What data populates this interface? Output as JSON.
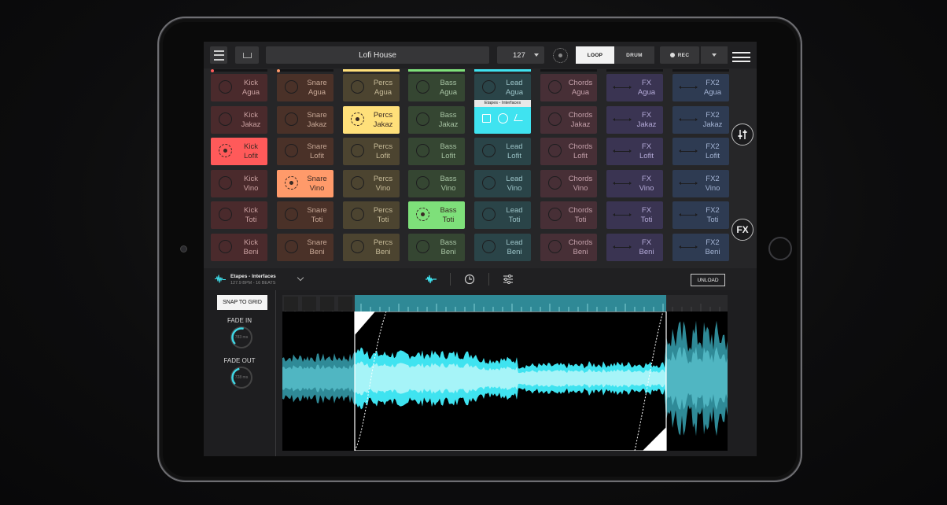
{
  "topbar": {
    "title": "Lofi House",
    "bpm": "127",
    "mode_loop": "LOOP",
    "mode_drum": "DRUM",
    "rec_label": "REC"
  },
  "columns": [
    {
      "name": "Kick",
      "color": "#ff5a5a",
      "pad_bg": "#4a2a2c",
      "text": "#c9a0a0",
      "icon": "ring",
      "playing_row": 2,
      "clips": [
        "Agua",
        "Jakaz",
        "Lofit",
        "Vino",
        "Toti",
        "Beni"
      ]
    },
    {
      "name": "Snare",
      "color": "#ff9a6a",
      "pad_bg": "#4a3128",
      "text": "#c8a896",
      "icon": "ring",
      "playing_row": 3,
      "clips": [
        "Agua",
        "Jakaz",
        "Lofit",
        "Vino",
        "Toti",
        "Beni"
      ]
    },
    {
      "name": "Percs",
      "color": "#ffe07a",
      "pad_bg": "#4c4430",
      "text": "#c7bb98",
      "icon": "ring",
      "playing_row": 1,
      "clips": [
        "Agua",
        "Jakaz",
        "Lofit",
        "Vino",
        "Toti",
        "Beni"
      ]
    },
    {
      "name": "Bass",
      "color": "#7ee07a",
      "pad_bg": "#354632",
      "text": "#a6c2a2",
      "icon": "ring",
      "playing_row": 4,
      "clips": [
        "Agua",
        "Jakaz",
        "Lofit",
        "Vino",
        "Toti",
        "Beni"
      ]
    },
    {
      "name": "Lead",
      "color": "#3fe3f0",
      "pad_bg": "#2a4448",
      "text": "#9cc4c8",
      "icon": "ring",
      "playing_row": 1,
      "clips": [
        "Agua",
        "Jakaz",
        "Lofit",
        "Vino",
        "Toti",
        "Beni"
      ]
    },
    {
      "name": "Chords",
      "color": "#c87a8e",
      "pad_bg": "#472f36",
      "text": "#c4a0aa",
      "icon": "ring",
      "playing_row": -1,
      "clips": [
        "Agua",
        "Jakaz",
        "Lofit",
        "Vino",
        "Toti",
        "Beni"
      ]
    },
    {
      "name": "FX",
      "color": "#9a8ae0",
      "pad_bg": "#3a3452",
      "text": "#b4aad8",
      "icon": "arrow",
      "playing_row": -1,
      "clips": [
        "Agua",
        "Jakaz",
        "Lofit",
        "Vino",
        "Toti",
        "Beni"
      ]
    },
    {
      "name": "FX2",
      "color": "#7aa0e0",
      "pad_bg": "#2e3b52",
      "text": "#a4b4d4",
      "icon": "arrow",
      "playing_row": -1,
      "clips": [
        "Agua",
        "Jakaz",
        "Lofit",
        "Vino",
        "Toti",
        "Beni"
      ]
    }
  ],
  "selected_pad": {
    "column": 4,
    "row": 1,
    "tooltip": "Etapes - Interfaces"
  },
  "side_buttons": {
    "mixer_icon": "sliders-icon",
    "fx_label": "FX",
    "edit_icon": "edit-icon",
    "folder_icon": "folder-icon"
  },
  "clip_info": {
    "name": "Etapes - Interfaces",
    "meta": "127.9 BPM - 16 BEATS",
    "unload": "UNLOAD"
  },
  "editor": {
    "snap": "SNAP TO GRID",
    "fade_in_label": "FADE IN",
    "fade_in_value": "783 ms",
    "fade_in_level": 0.55,
    "fade_out_label": "FADE OUT",
    "fade_out_value": "728 ms",
    "fade_out_level": 0.45
  }
}
